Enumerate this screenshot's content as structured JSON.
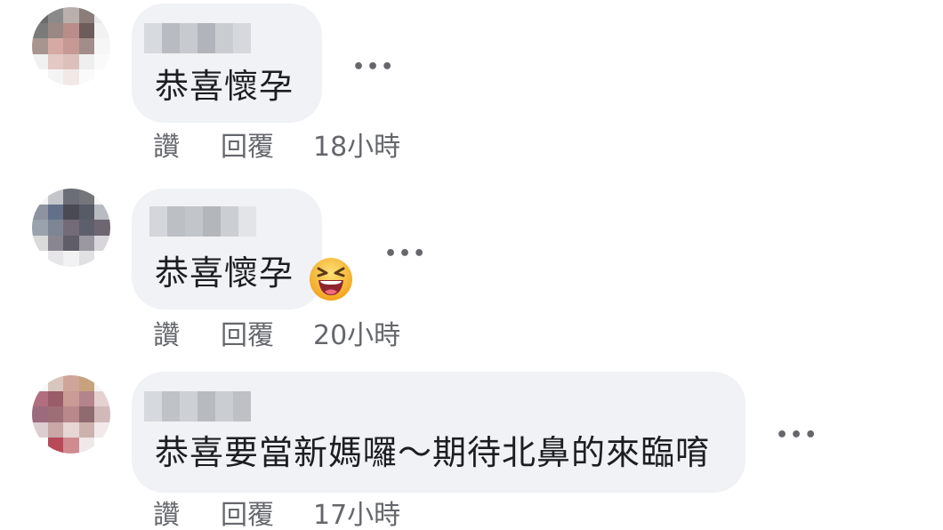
{
  "comments": [
    {
      "text": "恭喜懷孕",
      "like_label": "讚",
      "reply_label": "回覆",
      "time": "18小時",
      "more_label": "•••"
    },
    {
      "text": "恭喜懷孕",
      "emoji_icon": "laughing-face-emoji",
      "like_label": "讚",
      "reply_label": "回覆",
      "time": "20小時",
      "more_label": "•••"
    },
    {
      "text": "恭喜要當新媽囉～期待北鼻的來臨唷",
      "like_label": "讚",
      "reply_label": "回覆",
      "time": "17小時",
      "more_label": "•••"
    }
  ],
  "colors": {
    "bubble": "#f0f2f5",
    "text": "#1c1e21",
    "secondary": "#65676b",
    "emoji_face": "#f7b125",
    "emoji_mouth": "#a3323b"
  }
}
